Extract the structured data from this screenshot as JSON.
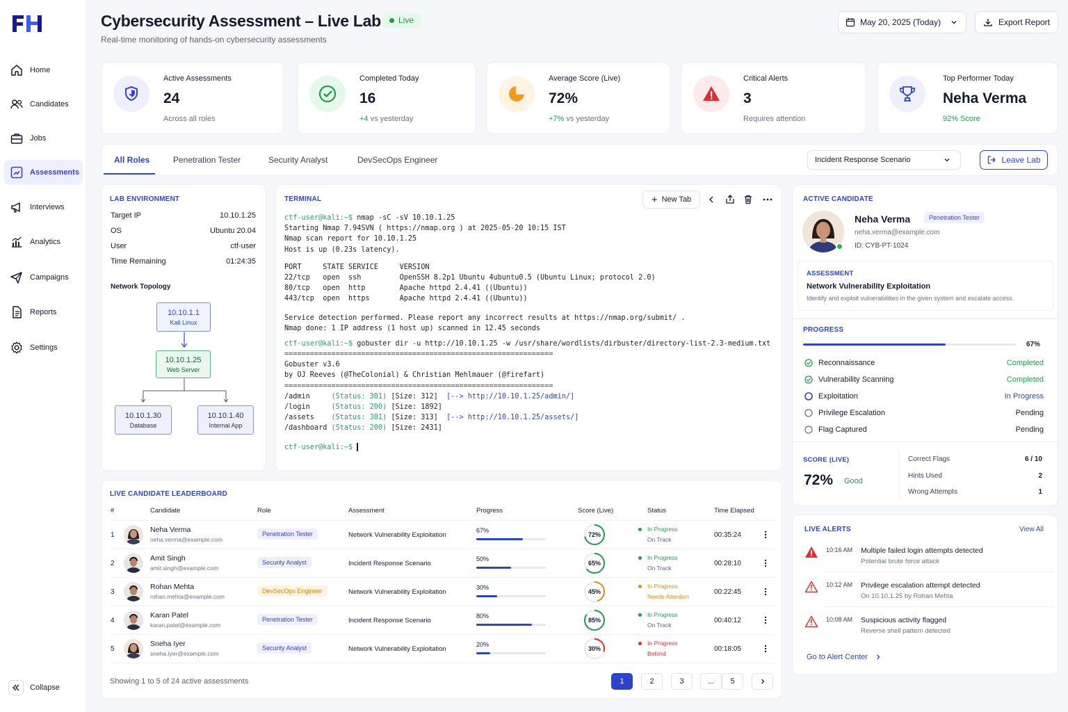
{
  "brand": {
    "logo_text": "FH"
  },
  "nav": {
    "items": [
      {
        "label": "Home",
        "icon": "home-icon"
      },
      {
        "label": "Candidates",
        "icon": "users-icon"
      },
      {
        "label": "Jobs",
        "icon": "briefcase-icon"
      },
      {
        "label": "Assessments",
        "icon": "assessment-icon"
      },
      {
        "label": "Interviews",
        "icon": "megaphone-icon"
      },
      {
        "label": "Analytics",
        "icon": "chart-icon"
      },
      {
        "label": "Campaigns",
        "icon": "send-icon"
      },
      {
        "label": "Reports",
        "icon": "document-icon"
      },
      {
        "label": "Settings",
        "icon": "gear-icon"
      }
    ],
    "active": "Assessments",
    "collapse_label": "Collapse"
  },
  "header": {
    "title": "Cybersecurity Assessment – Live Lab",
    "live_label": "Live",
    "subtitle": "Real-time monitoring of hands-on cybersecurity assessments",
    "date_label": "May 20, 2025 (Today)",
    "export_label": "Export Report"
  },
  "stats": [
    {
      "label": "Active Assessments",
      "value": "24",
      "sub": "Across all roles",
      "icon": "shield-icon"
    },
    {
      "label": "Completed Today",
      "value": "16",
      "sub_highlight": "+4",
      "sub": "vs yesterday",
      "icon": "check-circle-icon"
    },
    {
      "label": "Average Score (Live)",
      "value": "72%",
      "sub_highlight": "+7%",
      "sub": "vs yesterday",
      "icon": "pie-icon"
    },
    {
      "label": "Critical Alerts",
      "value": "3",
      "sub": "Requires attention",
      "icon": "warning-icon"
    },
    {
      "label": "Top Performer Today",
      "value": "Neha Verma",
      "sub": "92% Score",
      "icon": "trophy-icon"
    }
  ],
  "tabs": {
    "items": [
      "All Roles",
      "Penetration Tester",
      "Security Analyst",
      "DevSecOps Engineer"
    ],
    "active": "All Roles",
    "scenario_select": "Incident Response Scenario",
    "leave_label": "Leave Lab"
  },
  "lab": {
    "title": "LAB ENVIRONMENT",
    "fields": [
      {
        "label": "Target IP",
        "value": "10.10.1.25"
      },
      {
        "label": "OS",
        "value": "Ubuntu 20.04"
      },
      {
        "label": "User",
        "value": "ctf-user"
      },
      {
        "label": "Time Remaining",
        "value": "01:24:35"
      }
    ],
    "topology_title": "Network Topology",
    "nodes": [
      {
        "ip": "10.10.1.1",
        "name": "Kali Linux"
      },
      {
        "ip": "10.10.1.25",
        "name": "Web Server"
      },
      {
        "ip": "10.10.1.30",
        "name": "Database"
      },
      {
        "ip": "10.10.1.40",
        "name": "Internal App"
      }
    ]
  },
  "terminal": {
    "title": "TERMINAL",
    "new_tab_label": "New Tab",
    "prompt": "ctf-user@kali:~$",
    "cmd1": "nmap -sC -sV 10.10.1.25",
    "nmap_lines": [
      "Starting Nmap 7.94SVN ( https://nmap.org ) at 2025-05-20 10:15 IST",
      "Nmap scan report for 10.10.1.25",
      "Host is up (0.23s latency)."
    ],
    "port_header": "PORT     STATE SERVICE     VERSION",
    "ports": [
      "22/tcp   open  ssh         OpenSSH 8.2p1 Ubuntu 4ubuntu0.5 (Ubuntu Linux; protocol 2.0)",
      "80/tcp   open  http        Apache httpd 2.4.41 ((Ubuntu))",
      "443/tcp  open  https       Apache httpd 2.4.41 ((Ubuntu))"
    ],
    "nmap_footer": [
      "Service detection performed. Please report any incorrect results at https://nmap.org/submit/ .",
      "Nmap done: 1 IP address (1 host up) scanned in 12.45 seconds"
    ],
    "cmd2": "gobuster dir -u http://10.10.1.25 -w /usr/share/wordlists/dirbuster/directory-list-2.3-medium.txt",
    "rule": "===============================================================",
    "gobuster_lines": [
      "Gobuster v3.6",
      "by OJ Reeves (@TheColonial) & Christian Mehlmauer (@firefart)"
    ],
    "results": [
      {
        "path": "/admin     ",
        "status": "(Status: 301)",
        "size": " [Size: 312]",
        "redirect": "http://10.10.1.25/admin/]"
      },
      {
        "path": "/login     ",
        "status": "(Status: 200)",
        "size": " [Size: 1892]",
        "redirect": ""
      },
      {
        "path": "/assets    ",
        "status": "(Status: 301)",
        "size": " [Size: 313]",
        "redirect": "http://10.10.1.25/assets/]"
      },
      {
        "path": "/dashboard ",
        "status": "(Status: 200)",
        "size": " [Size: 2431]",
        "redirect": ""
      }
    ],
    "arrow": "[-->"
  },
  "active_candidate": {
    "title": "ACTIVE CANDIDATE",
    "name": "Neha Verma",
    "role": "Penetration Tester",
    "email": "neha.verma@example.com",
    "id": "ID: CYB-PT-1024",
    "assessment_title": "ASSESSMENT",
    "assessment_name": "Network Vulnerability Exploitation",
    "assessment_desc": "Identify and exploit vulnerabilities in the given system and escalate access.",
    "progress_title": "PROGRESS",
    "progress_value": "67%",
    "progress_fraction": 0.67,
    "steps": [
      {
        "label": "Reconnaissance",
        "status": "Completed",
        "state": "done"
      },
      {
        "label": "Vulnerability Scanning",
        "status": "Completed",
        "state": "done"
      },
      {
        "label": "Exploitation",
        "status": "In Progress",
        "state": "current"
      },
      {
        "label": "Privilege Escalation",
        "status": "Pending",
        "state": "pending"
      },
      {
        "label": "Flag Captured",
        "status": "Pending",
        "state": "pending"
      }
    ],
    "score_title": "SCORE (LIVE)",
    "score_value": "72%",
    "score_rating": "Good",
    "metrics": [
      {
        "label": "Correct Flags",
        "value": "6 / 10"
      },
      {
        "label": "Hints Used",
        "value": "2"
      },
      {
        "label": "Wrong Attempts",
        "value": "1"
      }
    ]
  },
  "leaderboard": {
    "title": "LIVE CANDIDATE LEADERBOARD",
    "columns": [
      "#",
      "Candidate",
      "Role",
      "Assessment",
      "Progress",
      "Score (Live)",
      "Status",
      "Time Elapsed"
    ],
    "rows": [
      {
        "rank": "1",
        "name": "Neha Verma",
        "email": "neha.verma@example.com",
        "role": "Penetration Tester",
        "role_kind": "pen",
        "assessment": "Network Vulnerability Exploitation",
        "progress": "67%",
        "progress_fraction": 0.67,
        "score": "72%",
        "score_fraction": 0.72,
        "status": "In Progress",
        "substatus": "On Track",
        "status_color": "#1f9d4a",
        "time": "00:35:24",
        "avatar": "f"
      },
      {
        "rank": "2",
        "name": "Amit Singh",
        "email": "amit.singh@example.com",
        "role": "Security Analyst",
        "role_kind": "sec",
        "assessment": "Incident Response Scenario",
        "progress": "50%",
        "progress_fraction": 0.5,
        "score": "65%",
        "score_fraction": 0.65,
        "status": "In Progress",
        "substatus": "On Track",
        "status_color": "#1f9d4a",
        "time": "00:28:10",
        "avatar": "m"
      },
      {
        "rank": "3",
        "name": "Rohan Mehta",
        "email": "rohan.mehta@example.com",
        "role": "DevSecOps Engineer",
        "role_kind": "dev",
        "assessment": "Network Vulnerability Exploitation",
        "progress": "30%",
        "progress_fraction": 0.3,
        "score": "45%",
        "score_fraction": 0.45,
        "status": "In Progress",
        "substatus": "Needs Attention",
        "status_color": "#e08a1a",
        "time": "00:22:45",
        "avatar": "m"
      },
      {
        "rank": "4",
        "name": "Karan Patel",
        "email": "karan.patel@example.com",
        "role": "Penetration Tester",
        "role_kind": "pen",
        "assessment": "Incident Response Scenario",
        "progress": "80%",
        "progress_fraction": 0.8,
        "score": "85%",
        "score_fraction": 0.85,
        "status": "In Progress",
        "substatus": "On Track",
        "status_color": "#1f9d4a",
        "time": "00:40:12",
        "avatar": "m"
      },
      {
        "rank": "5",
        "name": "Sneha Iyer",
        "email": "sneha.iyer@example.com",
        "role": "Security Analyst",
        "role_kind": "sec",
        "assessment": "Network Vulnerability Exploitation",
        "progress": "20%",
        "progress_fraction": 0.2,
        "score": "30%",
        "score_fraction": 0.3,
        "status": "In Progress",
        "substatus": "Behind",
        "status_color": "#e02d2d",
        "time": "00:18:05",
        "avatar": "f"
      }
    ],
    "footer": "Showing 1 to 5 of 24 active assessments",
    "pages": [
      "1",
      "2",
      "3",
      "...",
      "5"
    ],
    "active_page": "1"
  },
  "alerts": {
    "title": "LIVE ALERTS",
    "view_all": "View All",
    "items": [
      {
        "time": "10:16 AM",
        "title": "Multiple failed login attempts detected",
        "desc": "Potential brute force attack",
        "level": "critical"
      },
      {
        "time": "10:12 AM",
        "title": "Privilege escalation attempt detected",
        "desc": "On 10.10.1.25 by Rohan Mehta",
        "level": "warning"
      },
      {
        "time": "10:08 AM",
        "title": "Suspicious activity flagged",
        "desc": "Reverse shell pattern detected",
        "level": "warning"
      }
    ],
    "footer_link": "Go to Alert Center"
  },
  "colors": {
    "accent": "#2b44c9",
    "success": "#1f9d4a",
    "warning": "#e08a1a",
    "danger": "#e02d2d"
  }
}
